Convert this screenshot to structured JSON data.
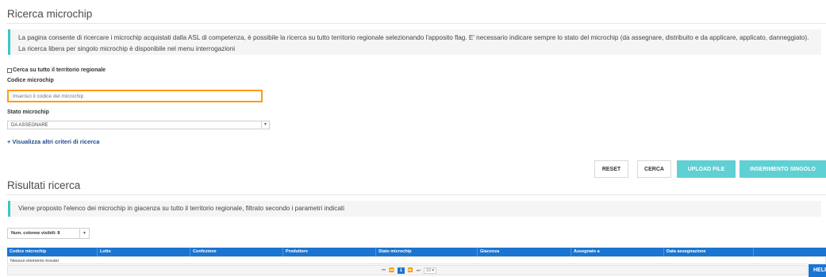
{
  "search": {
    "title": "Ricerca microchip",
    "info_text": "La pagina consente di ricercare i microchip acquistati dalla ASL di competenza, è possibile la ricerca su tutto territorio regionale selezionando l'apposito flag. E' necessario indicare sempre lo stato del microchip (da assegnare, distribuito e da applicare, applicato, danneggiato). La ricerca libera per singolo microchip è disponibile nel menu interrogazioni",
    "regional_checkbox_label": "Cerca su tutto il territorio regionale",
    "code_label": "Codice microchip",
    "code_placeholder": "Inserisci il codice del microchip",
    "code_value": "",
    "state_label": "Stato microchip",
    "state_value": "DA ASSEGNARE",
    "more_criteria_link": "+ Visualizza altri criteri di ricerca"
  },
  "actions": {
    "reset": "RESET",
    "search": "CERCA",
    "upload": "UPLOAD FILE",
    "single_insert": "INSERIMENTO SINGOLO"
  },
  "results": {
    "title": "Risultati ricerca",
    "info_text": "Viene proposto l'elenco dei microchip in giacenza su tutto il territorio regionale, filtrato secondo i parametri indicati",
    "visible_columns": "Num. colonne visibili: 8",
    "columns": [
      "Codice microchip",
      "Lotto",
      "Confezione",
      "Produttore",
      "Stato microchip",
      "Giacenza",
      "Assegnato a",
      "Data assegnazione",
      ""
    ],
    "empty_text": "Nessun elemento trovato"
  },
  "pager": {
    "first": "⏮",
    "prev": "⏪",
    "current_page": "1",
    "next": "⏩",
    "last": "⏭",
    "page_size": "10"
  },
  "help": {
    "label": "HELP"
  },
  "colors": {
    "accent": "#1a75d2",
    "teal": "#5fd0d3",
    "focus": "#ff9a1a",
    "info_bar": "#3cc5c9"
  }
}
